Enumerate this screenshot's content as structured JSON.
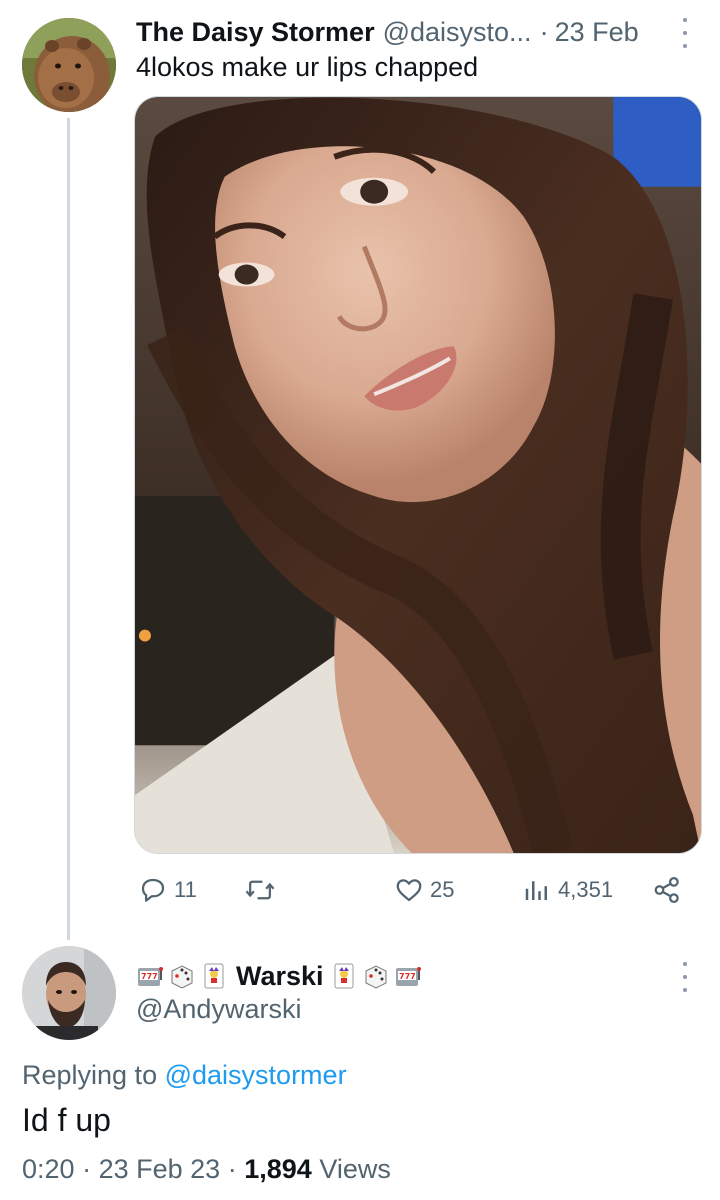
{
  "tweet": {
    "author": {
      "display_name": "The Daisy Stormer",
      "handle": "@daisysto...",
      "avatar_icon": "capybara-avatar"
    },
    "separator": "·",
    "date": "23 Feb",
    "text": "4lokos make ur lips chapped",
    "media": {
      "type": "photo",
      "icon": "selfie-photo"
    },
    "actions": {
      "replies": "11",
      "retweets": "",
      "likes": "25",
      "views": "4,351"
    }
  },
  "reply": {
    "author": {
      "display_name": "Warski",
      "handle": "@Andywarski",
      "name_emojis_left": [
        "slot-machine-emoji",
        "dice-emoji",
        "joker-card-emoji"
      ],
      "name_emojis_right": [
        "joker-card-emoji",
        "dice-emoji",
        "slot-machine-emoji"
      ]
    },
    "replying_prefix": "Replying to",
    "replying_to": "@daisystormer",
    "text": "Id f up",
    "meta": {
      "time": "0:20",
      "separator": "·",
      "date": "23 Feb 23",
      "views_count": "1,894",
      "views_label": "Views"
    }
  },
  "colors": {
    "text_primary": "#0f1419",
    "text_secondary": "#536471",
    "link": "#1d9bf0",
    "thread_line": "#cfd9de"
  }
}
